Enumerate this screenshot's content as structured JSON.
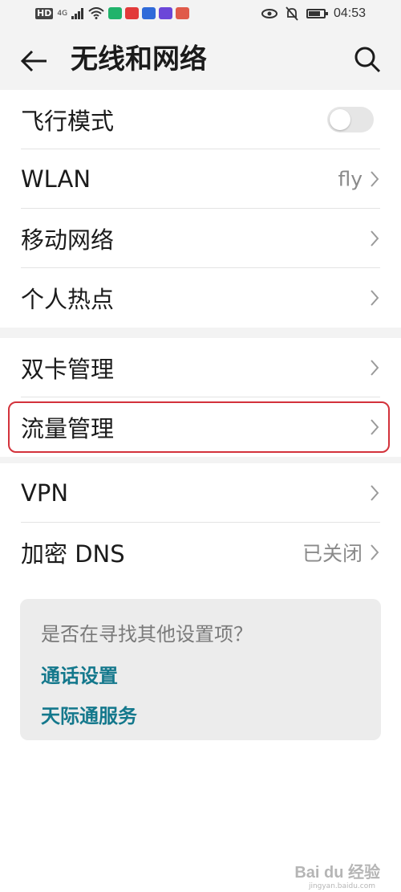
{
  "status_bar": {
    "hd": "HD",
    "signal": "4G",
    "app_icons": [
      {
        "name": "app-icon-green",
        "color": "#20b36b"
      },
      {
        "name": "app-icon-red",
        "color": "#e23a3a"
      },
      {
        "name": "app-icon-blue",
        "color": "#2f6ad9"
      },
      {
        "name": "app-icon-purple",
        "color": "#6b46d8"
      },
      {
        "name": "app-icon-salmon",
        "color": "#e05a4a"
      }
    ],
    "time": "04:53",
    "battery_level": 0.75
  },
  "header": {
    "title": "无线和网络"
  },
  "groups": [
    {
      "rows": [
        {
          "label": "飞行模式",
          "type": "toggle",
          "on": false
        },
        {
          "label": "WLAN",
          "type": "nav",
          "value": "fly"
        },
        {
          "label": "移动网络",
          "type": "nav"
        },
        {
          "label": "个人热点",
          "type": "nav"
        }
      ]
    },
    {
      "rows": [
        {
          "label": "双卡管理",
          "type": "nav"
        },
        {
          "label": "流量管理",
          "type": "nav",
          "highlighted": true
        }
      ]
    },
    {
      "rows": [
        {
          "label": "VPN",
          "type": "nav"
        },
        {
          "label": "加密 DNS",
          "type": "nav",
          "value": "已关闭"
        }
      ]
    }
  ],
  "suggestions": {
    "question": "是否在寻找其他设置项？",
    "links": [
      "通话设置",
      "天际通服务"
    ]
  },
  "colors": {
    "accent_link": "#14788c",
    "highlight_border": "#d3323b"
  },
  "watermark": {
    "text": "Bai du 经验",
    "sub": "jingyan.baidu.com"
  }
}
